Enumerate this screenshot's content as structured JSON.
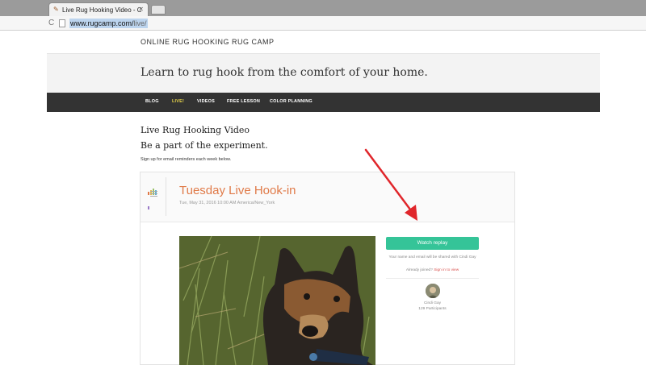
{
  "browser": {
    "tab_title": "Live Rug Hooking Video - C",
    "url_host": "www.rugcamp.com/",
    "url_path": "live/"
  },
  "site": {
    "title": "ONLINE RUG HOOKING RUG CAMP",
    "tagline": "Learn to rug hook from the comfort of your home."
  },
  "nav": {
    "items": [
      {
        "label": "BLOG",
        "active": false
      },
      {
        "label": "LIVE!",
        "active": true
      },
      {
        "label": "VIDEOS",
        "active": false
      },
      {
        "label": "FREE LESSON",
        "active": false
      },
      {
        "label": "COLOR PLANNING",
        "active": false
      }
    ]
  },
  "content": {
    "title": "Live Rug Hooking Video",
    "subtitle": "Be a part of the experiment.",
    "signup_note": "Sign up for email reminders each week below."
  },
  "event": {
    "title": "Tuesday Live Hook-in",
    "datetime": "Tue, May 31, 2016 10:00 AM America/New_York",
    "replay_label": "Watch replay",
    "share_note": "Your name and email will be shared with Cindi Gay",
    "already_joined": "Already joined?",
    "signin_link": "Sign in to view",
    "host_name": "Cindi Gay",
    "participants": "129 Participants"
  },
  "colors": {
    "accent_orange": "#e07a48",
    "replay_green": "#35c498",
    "nav_bg": "#333333",
    "nav_active": "#e7d34a",
    "arrow_red": "#e0262b"
  }
}
